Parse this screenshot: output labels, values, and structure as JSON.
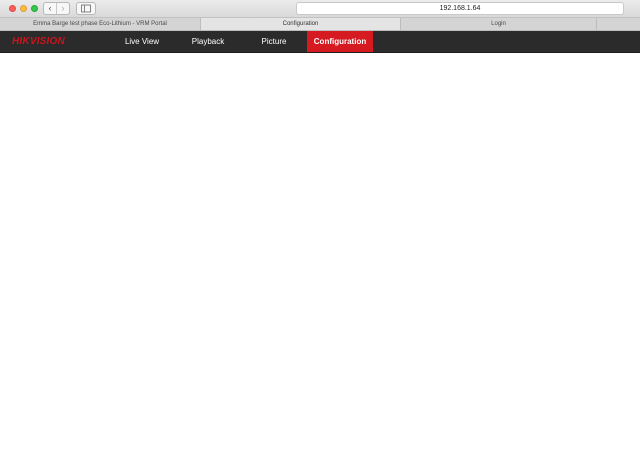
{
  "browser": {
    "address": "192.168.1.64",
    "tabs": [
      {
        "label": "Emma Barge test phase Eco-Lithium - VRM Portal",
        "active": false
      },
      {
        "label": "Configuration",
        "active": true
      },
      {
        "label": "Login",
        "active": false
      }
    ],
    "nav_back_icon": "chevron-left-icon",
    "nav_forward_icon": "chevron-right-icon",
    "sidebar_icon": "sidebar-icon"
  },
  "app": {
    "logo": "HIKVISION",
    "menu": {
      "live_view": "Live View",
      "playback": "Playback",
      "picture": "Picture",
      "configuration": "Configuration"
    },
    "active_menu": "Configuration",
    "accent_color": "#d51a21"
  }
}
